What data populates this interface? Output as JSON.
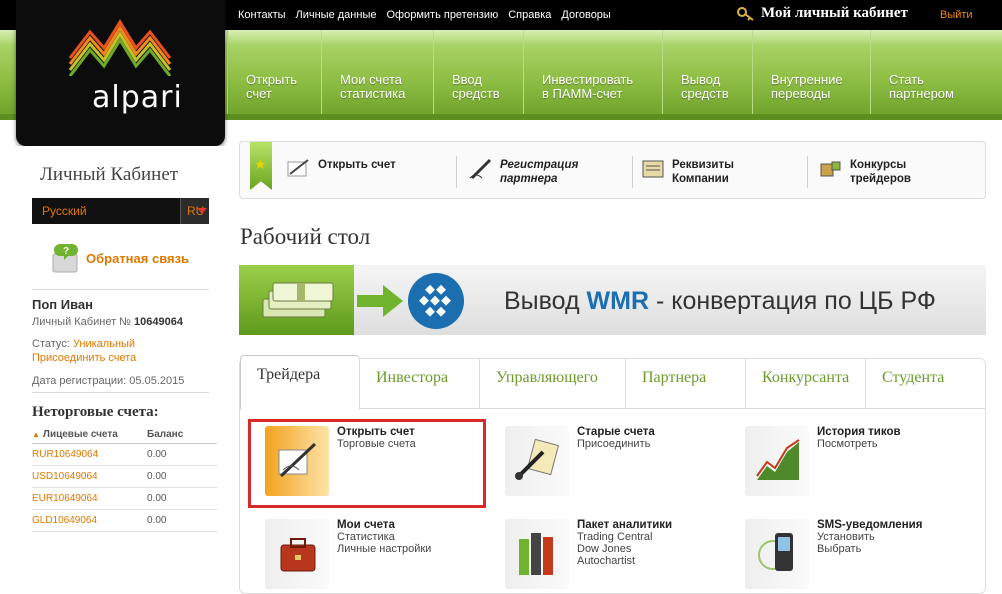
{
  "top": {
    "links": [
      "Контакты",
      "Личные данные",
      "Оформить претензию",
      "Справка",
      "Договоры"
    ],
    "cabinet": "Мой личный кабинет",
    "logout": "Выйти"
  },
  "logo": {
    "text": "alpari"
  },
  "nav": [
    {
      "l1": "Открыть",
      "l2": "счет"
    },
    {
      "l1": "Мои счета",
      "l2": "статистика"
    },
    {
      "l1": "Ввод",
      "l2": "средств"
    },
    {
      "l1": "Инвестировать",
      "l2": "в ПАММ-счет"
    },
    {
      "l1": "Вывод",
      "l2": "средств"
    },
    {
      "l1": "Внутренние",
      "l2": "переводы"
    },
    {
      "l1": "Стать",
      "l2": "партнером"
    }
  ],
  "sidebar": {
    "title": "Личный Кабинет",
    "language": "Русский",
    "lang_code": "RU",
    "feedback": "Обратная связь",
    "user_name": "Поп Иван",
    "cabinet_no_label": "Личный Кабинет №",
    "cabinet_no": "10649064",
    "status_label": "Статус:",
    "status_value": "Уникальный",
    "join_accounts": "Присоединить счета",
    "reg_date_label": "Дата регистрации:",
    "reg_date": "05.05.2015",
    "nontrade_title": "Неторговые счета:",
    "col_accounts": "Лицевые счета",
    "col_balance": "Баланс",
    "accounts": [
      {
        "id": "RUR10649064",
        "balance": "0.00"
      },
      {
        "id": "USD10649064",
        "balance": "0.00"
      },
      {
        "id": "EUR10649064",
        "balance": "0.00"
      },
      {
        "id": "GLD10649064",
        "balance": "0.00"
      }
    ]
  },
  "quickbar": [
    {
      "l1": "Открыть счет",
      "l2": ""
    },
    {
      "l1": "Регистрация",
      "l2": "партнера"
    },
    {
      "l1": "Реквизиты",
      "l2": "Компании"
    },
    {
      "l1": "Конкурсы",
      "l2": "трейдеров"
    }
  ],
  "page_title": "Рабочий стол",
  "banner": {
    "prefix": "Вывод ",
    "highlight": "WMR",
    "suffix": " - конвертация по ЦБ РФ"
  },
  "tabs": [
    "Трейдера",
    "Инвестора",
    "Управляющего",
    "Партнера",
    "Конкурсанта",
    "Студента"
  ],
  "tiles": [
    {
      "title": "Открыть счет",
      "subs": [
        "Торговые счета"
      ]
    },
    {
      "title": "Старые счета",
      "subs": [
        "Присоединить"
      ]
    },
    {
      "title": "История тиков",
      "subs": [
        "Посмотреть"
      ]
    },
    {
      "title": "Мои счета",
      "subs": [
        "Статистика",
        "Личные настройки"
      ]
    },
    {
      "title": "Пакет аналитики",
      "subs": [
        "Trading Central",
        "Dow Jones",
        "Autochartist"
      ]
    },
    {
      "title": "SMS-уведомления",
      "subs": [
        "Установить",
        "Выбрать"
      ]
    }
  ],
  "colors": {
    "accent_orange": "#e07800",
    "nav_green": "#8fbf45",
    "highlight_red": "#d42a2a",
    "wmr_blue": "#1b6fb0"
  }
}
